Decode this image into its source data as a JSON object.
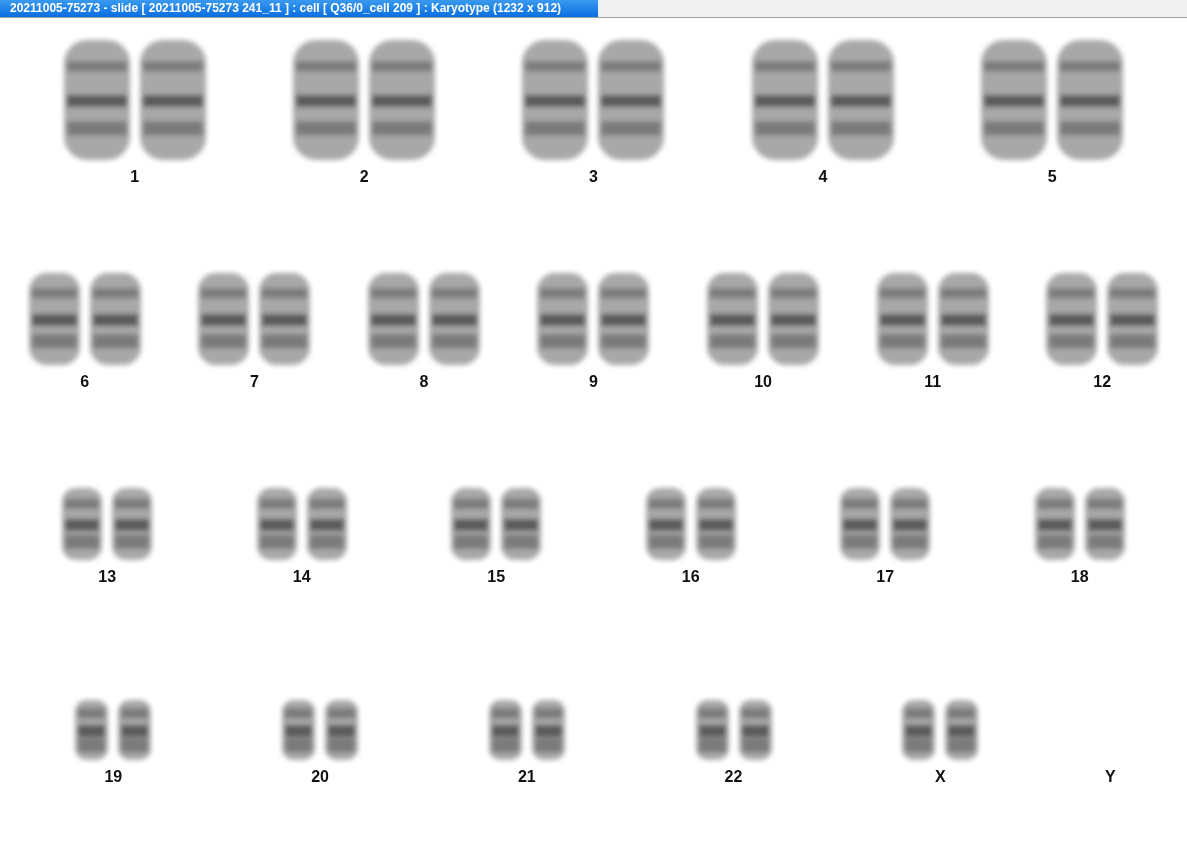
{
  "window": {
    "title": "20211005-75273 - slide [ 20211005-75273 241_11 ] : cell [ Q36/0_cell 209 ] : Karyotype  (1232 x 912)"
  },
  "karyotype": {
    "rows": [
      {
        "pairs": [
          {
            "label": "1",
            "kind": "pair"
          },
          {
            "label": "2",
            "kind": "pair"
          },
          {
            "label": "3",
            "kind": "pair"
          },
          {
            "label": "4",
            "kind": "pair"
          },
          {
            "label": "5",
            "kind": "pair"
          }
        ]
      },
      {
        "pairs": [
          {
            "label": "6",
            "kind": "pair"
          },
          {
            "label": "7",
            "kind": "pair"
          },
          {
            "label": "8",
            "kind": "pair"
          },
          {
            "label": "9",
            "kind": "pair"
          },
          {
            "label": "10",
            "kind": "pair"
          },
          {
            "label": "11",
            "kind": "pair"
          },
          {
            "label": "12",
            "kind": "pair"
          }
        ]
      },
      {
        "pairs": [
          {
            "label": "13",
            "kind": "pair"
          },
          {
            "label": "14",
            "kind": "pair"
          },
          {
            "label": "15",
            "kind": "pair"
          },
          {
            "label": "16",
            "kind": "pair"
          },
          {
            "label": "17",
            "kind": "pair"
          },
          {
            "label": "18",
            "kind": "pair"
          }
        ]
      },
      {
        "pairs": [
          {
            "label": "19",
            "kind": "pair"
          },
          {
            "label": "20",
            "kind": "pair"
          },
          {
            "label": "21",
            "kind": "pair"
          },
          {
            "label": "22",
            "kind": "pair"
          },
          {
            "label": "X",
            "kind": "pair"
          },
          {
            "label": "Y",
            "kind": "empty"
          }
        ]
      }
    ]
  }
}
